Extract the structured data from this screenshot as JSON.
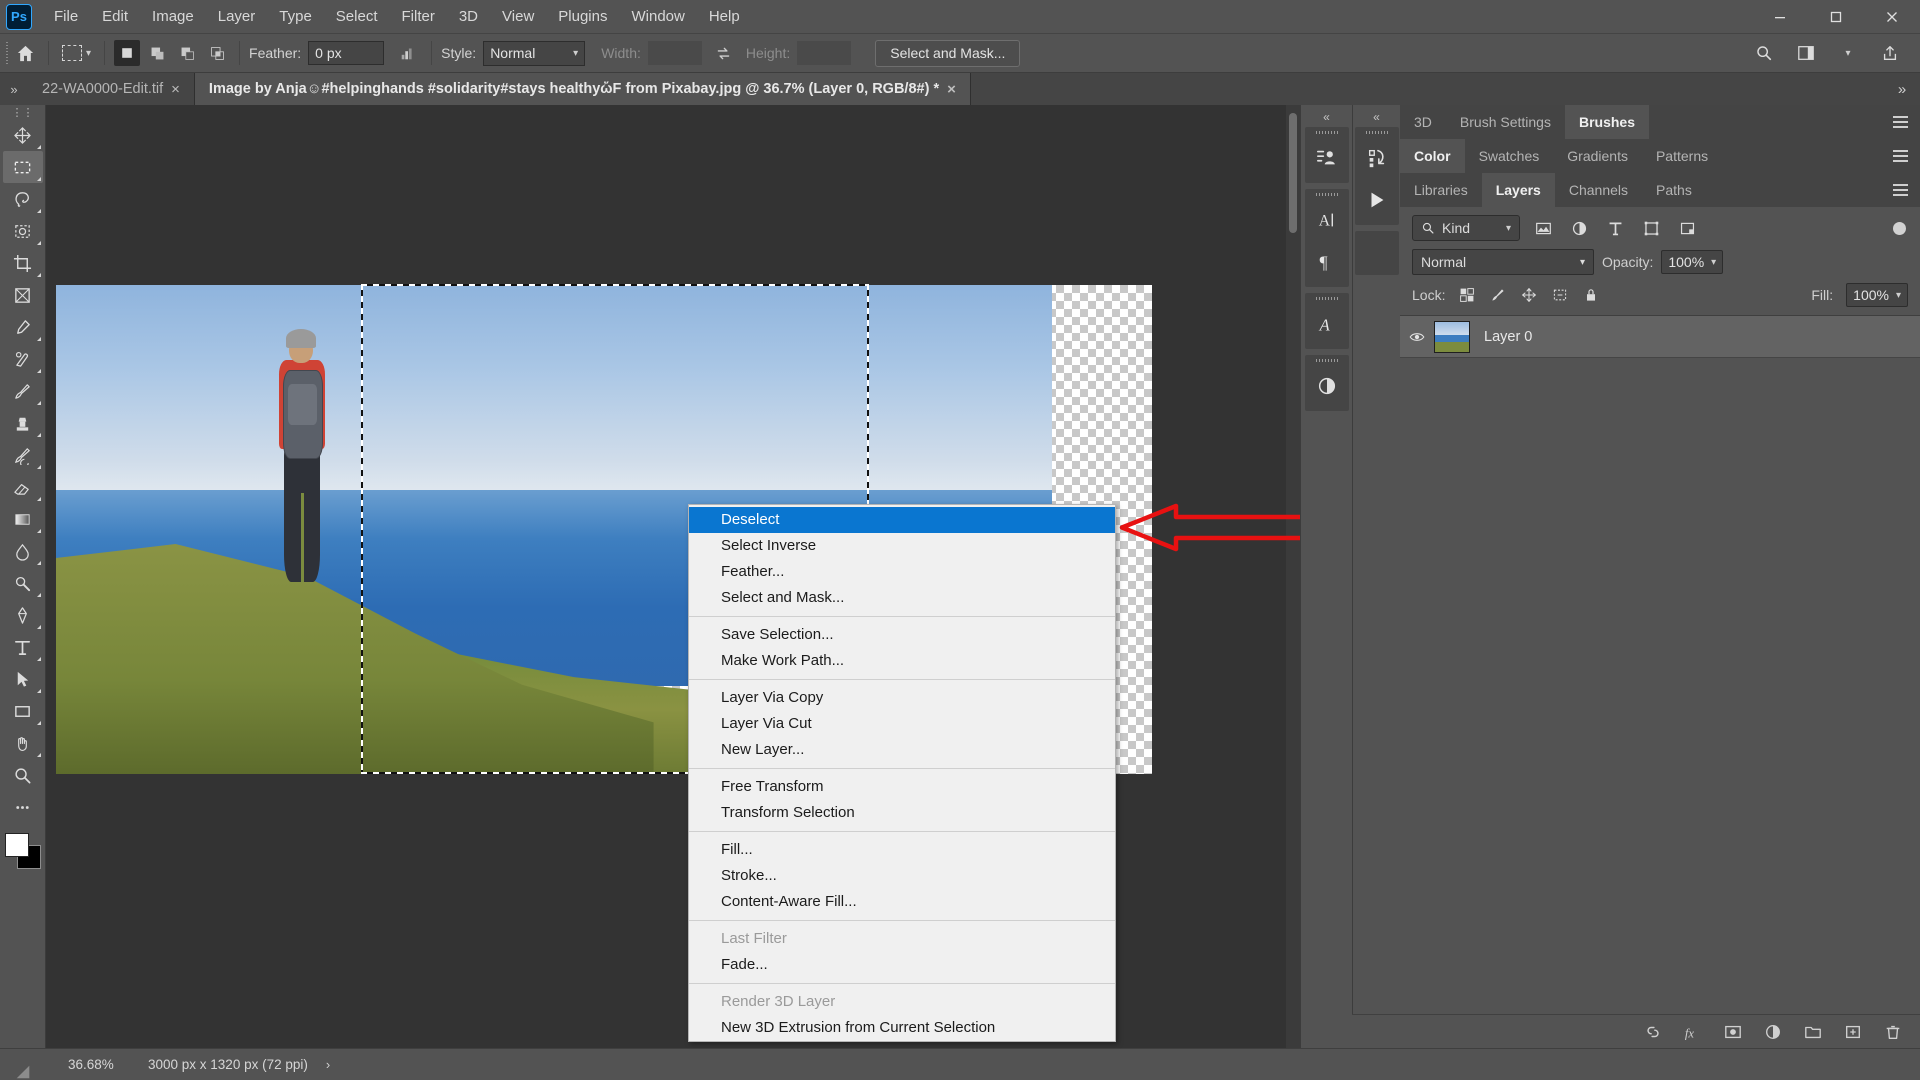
{
  "app": {
    "logo": "Ps",
    "menus": [
      "File",
      "Edit",
      "Image",
      "Layer",
      "Type",
      "Select",
      "Filter",
      "3D",
      "View",
      "Plugins",
      "Window",
      "Help"
    ],
    "window_controls": {
      "minimize": "minimize-icon",
      "restore": "restore-icon",
      "close": "close-icon"
    }
  },
  "options_bar": {
    "home_icon": "home-icon",
    "tool": "rectangular-marquee-tool",
    "bool_modes": [
      "new-selection",
      "add-to-selection",
      "subtract-from-selection",
      "intersect-selection"
    ],
    "feather_label": "Feather:",
    "feather_value": "0 px",
    "antialias_icon": "anti-alias-icon",
    "style_label": "Style:",
    "style_value": "Normal",
    "width_label": "Width:",
    "width_value": "",
    "swap_icon": "swap-dimensions-icon",
    "height_label": "Height:",
    "height_value": "",
    "select_and_mask": "Select and Mask...",
    "right_icons": [
      "search-icon",
      "workspace-icon",
      "chevron-down-icon",
      "share-icon"
    ]
  },
  "tabs": {
    "overflow_left": "»",
    "overflow_right": "»",
    "items": [
      {
        "title": "22-WA0000-Edit.tif",
        "active": false,
        "close": "×"
      },
      {
        "title": "Image by Anja☺#helpinghands #solidarity#stays healthyὤF from Pixabay.jpg @ 36.7% (Layer 0, RGB/8#) *",
        "active": true,
        "close": "×"
      }
    ]
  },
  "toolbar": {
    "tools": [
      {
        "name": "move-tool",
        "active": false
      },
      {
        "name": "rectangular-marquee-tool",
        "active": true
      },
      {
        "name": "lasso-tool",
        "active": false
      },
      {
        "name": "object-selection-tool",
        "active": false
      },
      {
        "name": "crop-tool",
        "active": false
      },
      {
        "name": "frame-tool",
        "active": false
      },
      {
        "name": "eyedropper-tool",
        "active": false
      },
      {
        "name": "spot-healing-brush-tool",
        "active": false
      },
      {
        "name": "brush-tool",
        "active": false
      },
      {
        "name": "clone-stamp-tool",
        "active": false
      },
      {
        "name": "history-brush-tool",
        "active": false
      },
      {
        "name": "eraser-tool",
        "active": false
      },
      {
        "name": "gradient-tool",
        "active": false
      },
      {
        "name": "blur-tool",
        "active": false
      },
      {
        "name": "dodge-tool",
        "active": false
      },
      {
        "name": "pen-tool",
        "active": false
      },
      {
        "name": "type-tool",
        "active": false
      },
      {
        "name": "path-selection-tool",
        "active": false
      },
      {
        "name": "rectangle-tool",
        "active": false
      },
      {
        "name": "hand-tool",
        "active": false
      },
      {
        "name": "zoom-tool",
        "active": false
      },
      {
        "name": "edit-toolbar-tool",
        "active": false
      }
    ],
    "foreground_color": "#ffffff",
    "background_color": "#000000"
  },
  "context_menu": {
    "groups": [
      [
        {
          "label": "Deselect",
          "selected": true,
          "disabled": false
        },
        {
          "label": "Select Inverse",
          "selected": false,
          "disabled": false
        },
        {
          "label": "Feather...",
          "selected": false,
          "disabled": false
        },
        {
          "label": "Select and Mask...",
          "selected": false,
          "disabled": false
        }
      ],
      [
        {
          "label": "Save Selection...",
          "selected": false,
          "disabled": false
        },
        {
          "label": "Make Work Path...",
          "selected": false,
          "disabled": false
        }
      ],
      [
        {
          "label": "Layer Via Copy",
          "selected": false,
          "disabled": false
        },
        {
          "label": "Layer Via Cut",
          "selected": false,
          "disabled": false
        },
        {
          "label": "New Layer...",
          "selected": false,
          "disabled": false
        }
      ],
      [
        {
          "label": "Free Transform",
          "selected": false,
          "disabled": false
        },
        {
          "label": "Transform Selection",
          "selected": false,
          "disabled": false
        }
      ],
      [
        {
          "label": "Fill...",
          "selected": false,
          "disabled": false
        },
        {
          "label": "Stroke...",
          "selected": false,
          "disabled": false
        },
        {
          "label": "Content-Aware Fill...",
          "selected": false,
          "disabled": false
        }
      ],
      [
        {
          "label": "Last Filter",
          "selected": false,
          "disabled": true
        },
        {
          "label": "Fade...",
          "selected": false,
          "disabled": false
        }
      ],
      [
        {
          "label": "Render 3D Layer",
          "selected": false,
          "disabled": true
        },
        {
          "label": "New 3D Extrusion from Current Selection",
          "selected": false,
          "disabled": false
        }
      ]
    ]
  },
  "mini_dock": {
    "column_a_chevron": "«",
    "column_b_chevron": "«",
    "groups": [
      [
        "adjustments-icon"
      ],
      [
        "character-icon",
        "paragraph-icon"
      ],
      [
        "character-styles-icon"
      ],
      [
        "properties-icon"
      ]
    ],
    "column_b": [
      "actions-icon",
      "play-icon"
    ]
  },
  "panels": {
    "row1": {
      "tabs": [
        "3D",
        "Brush Settings",
        "Brushes"
      ],
      "active": "Brushes",
      "menu": "panel-menu-icon"
    },
    "row2": {
      "tabs": [
        "Color",
        "Swatches",
        "Gradients",
        "Patterns"
      ],
      "active": "Color",
      "menu": "panel-menu-icon"
    },
    "row3": {
      "tabs": [
        "Libraries",
        "Layers",
        "Channels",
        "Paths"
      ],
      "active": "Layers",
      "menu": "panel-menu-icon"
    }
  },
  "layers_panel": {
    "filter_kind": "Kind",
    "filter_icons": [
      "pixel-layers-filter-icon",
      "adjustment-layers-filter-icon",
      "type-layers-filter-icon",
      "shape-layers-filter-icon",
      "smart-object-filter-icon"
    ],
    "filter_toggle": "filter-enable-toggle",
    "blend_mode": "Normal",
    "opacity_label": "Opacity:",
    "opacity_value": "100%",
    "lock_label": "Lock:",
    "lock_icons": [
      "lock-transparent-pixels-icon",
      "lock-image-pixels-icon",
      "lock-position-icon",
      "lock-artboard-nesting-icon",
      "lock-all-icon"
    ],
    "fill_label": "Fill:",
    "fill_value": "100%",
    "layers": [
      {
        "name": "Layer 0",
        "visible": true,
        "thumbnail": "landscape-thumbnail"
      }
    ],
    "footer_icons": [
      "link-layers-icon",
      "layer-style-fx-icon",
      "add-layer-mask-icon",
      "new-adjustment-layer-icon",
      "new-group-icon",
      "new-layer-icon",
      "delete-layer-icon"
    ]
  },
  "status_bar": {
    "zoom": "36.68%",
    "doc_info": "3000 px x 1320 px (72 ppi)",
    "expand_arrow": "›"
  },
  "annotation": {
    "arrow": "red-arrow-pointing-left",
    "arrow_color": "#e81111"
  },
  "colors": {
    "app_bg": "#535353",
    "panel_bg": "#454545",
    "canvas_bg": "#333333",
    "menu_highlight": "#0a76d0",
    "menu_bg": "#f0f0f0",
    "accent": "#31a8ff"
  }
}
